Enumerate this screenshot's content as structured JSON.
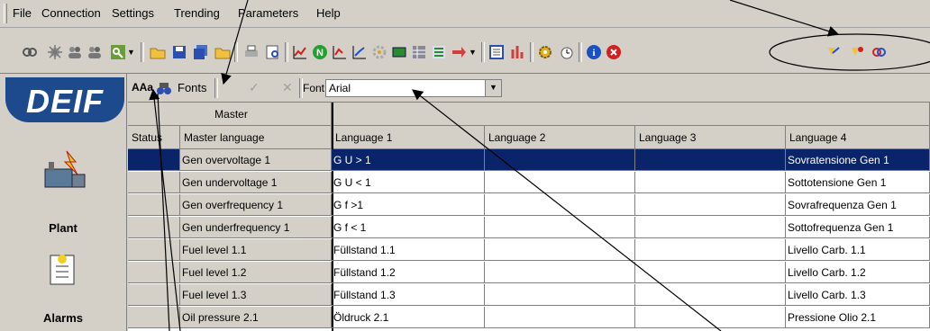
{
  "menu": [
    "File",
    "Connection",
    "Settings",
    "Trending",
    "Parameters",
    "Help"
  ],
  "toolbar_icons": [
    "link-icon",
    "virus-icon",
    "users-icon",
    "users-add-icon",
    "key-icon",
    "open-folder-icon",
    "save-icon",
    "save-all-icon",
    "folder-icon",
    "print-icon",
    "print-preview-icon",
    "graph-icon",
    "green-n-icon",
    "chart-icon",
    "chart-up-icon",
    "tools-icon",
    "battery-icon",
    "table-icon",
    "list-icon",
    "export-icon",
    "window-icon",
    "sort-icon",
    "gear-icon",
    "clock-icon",
    "info-icon",
    "close-icon",
    "translate-icon",
    "translate-star-icon",
    "translate-link-icon"
  ],
  "logo": {
    "text": "DEIF"
  },
  "nav": [
    {
      "label": "Plant",
      "icon": "plant-icon"
    },
    {
      "label": "Alarms",
      "icon": "alarms-icon"
    }
  ],
  "subbar": {
    "fonts_label": "Fonts",
    "font_label": "Font:",
    "font_value": "Arial"
  },
  "grid": {
    "group_header": "Master",
    "columns": [
      "Status",
      "Master language",
      "Language 1",
      "Language 2",
      "Language 3",
      "Language 4"
    ],
    "rows": [
      {
        "status": "",
        "master": "Gen overvoltage 1",
        "l1": "G U > 1",
        "l2": "",
        "l3": "",
        "l4": "Sovratensione Gen 1"
      },
      {
        "status": "",
        "master": "Gen undervoltage 1",
        "l1": "G U < 1",
        "l2": "",
        "l3": "",
        "l4": "Sottotensione Gen 1"
      },
      {
        "status": "",
        "master": "Gen overfrequency 1",
        "l1": "G f >1",
        "l2": "",
        "l3": "",
        "l4": "Sovrafrequenza Gen 1"
      },
      {
        "status": "",
        "master": "Gen underfrequency 1",
        "l1": "G f < 1",
        "l2": "",
        "l3": "",
        "l4": "Sottofrequenza Gen 1"
      },
      {
        "status": "",
        "master": "Fuel level 1.1",
        "l1": "Füllstand  1.1",
        "l2": "",
        "l3": "",
        "l4": "Livello Carb. 1.1"
      },
      {
        "status": "",
        "master": "Fuel level 1.2",
        "l1": "Füllstand  1.2",
        "l2": "",
        "l3": "",
        "l4": "Livello Carb.  1.2"
      },
      {
        "status": "",
        "master": "Fuel level 1.3",
        "l1": "Füllstand  1.3",
        "l2": "",
        "l3": "",
        "l4": "Livello Carb.  1.3"
      },
      {
        "status": "",
        "master": "Oil pressure 2.1",
        "l1": "Öldruck 2.1",
        "l2": "",
        "l3": "",
        "l4": "Pressione Olio 2.1"
      }
    ]
  },
  "colors": {
    "selection": "#0a246a",
    "logo": "#1c4a8c",
    "chrome": "#d4d0c8"
  }
}
